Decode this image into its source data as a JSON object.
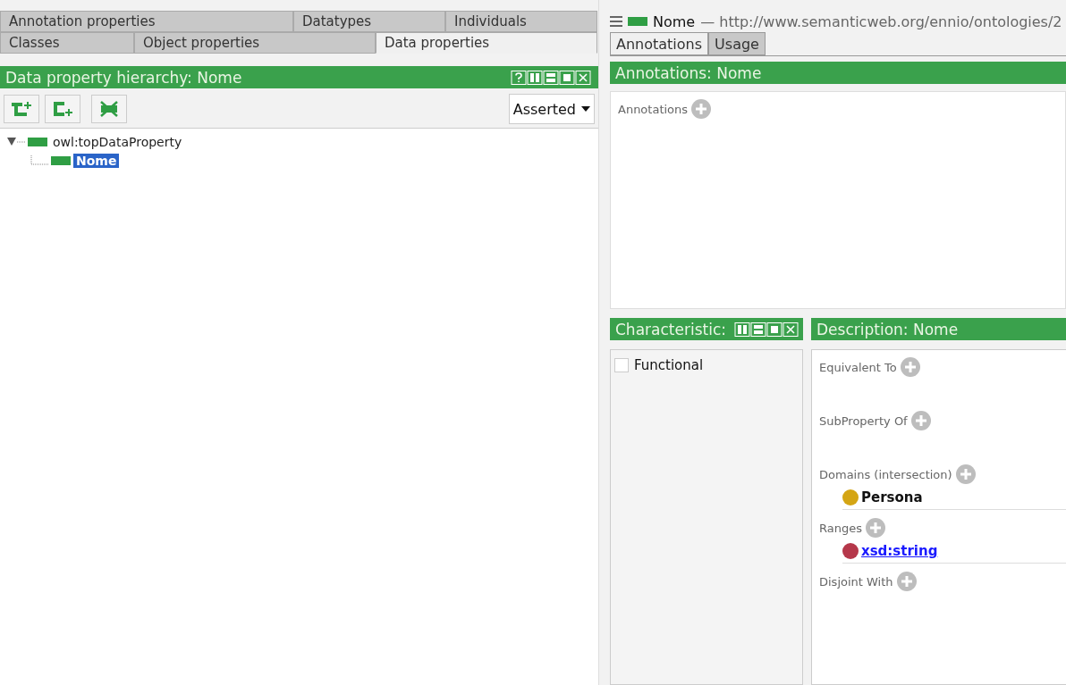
{
  "left": {
    "tab_rows": [
      [
        {
          "label": "Annotation properties",
          "selected": false
        },
        {
          "label": "Datatypes",
          "selected": false
        },
        {
          "label": "Individuals",
          "selected": false
        }
      ],
      [
        {
          "label": "Classes",
          "selected": false
        },
        {
          "label": "Object properties",
          "selected": false
        },
        {
          "label": "Data properties",
          "selected": true
        }
      ]
    ],
    "hierarchy": {
      "title": "Data property hierarchy: Nome",
      "mode": "Asserted",
      "tree": [
        {
          "label": "owl:topDataProperty",
          "selected": false,
          "expanded": true,
          "children": [
            {
              "label": "Nome",
              "selected": true
            }
          ]
        }
      ]
    }
  },
  "right": {
    "entity": {
      "name": "Nome",
      "iri": "— http://www.semanticweb.org/ennio/ontologies/2"
    },
    "tabs": [
      {
        "label": "Annotations",
        "selected": true
      },
      {
        "label": "Usage",
        "selected": false
      }
    ],
    "annotations": {
      "title": "Annotations: Nome",
      "section": "Annotations"
    },
    "characteristics": {
      "title": "Characteristic:",
      "items": [
        {
          "label": "Functional",
          "checked": false
        }
      ]
    },
    "description": {
      "title": "Description: Nome",
      "sections": [
        {
          "label": "Equivalent To"
        },
        {
          "label": "SubProperty Of"
        },
        {
          "label": "Domains (intersection)",
          "items": [
            {
              "kind": "class",
              "label": "Persona",
              "color": "#d4a514"
            }
          ]
        },
        {
          "label": "Ranges",
          "items": [
            {
              "kind": "datatype",
              "label": "xsd:string",
              "color": "#b5374a"
            }
          ]
        },
        {
          "label": "Disjoint With"
        }
      ]
    }
  }
}
